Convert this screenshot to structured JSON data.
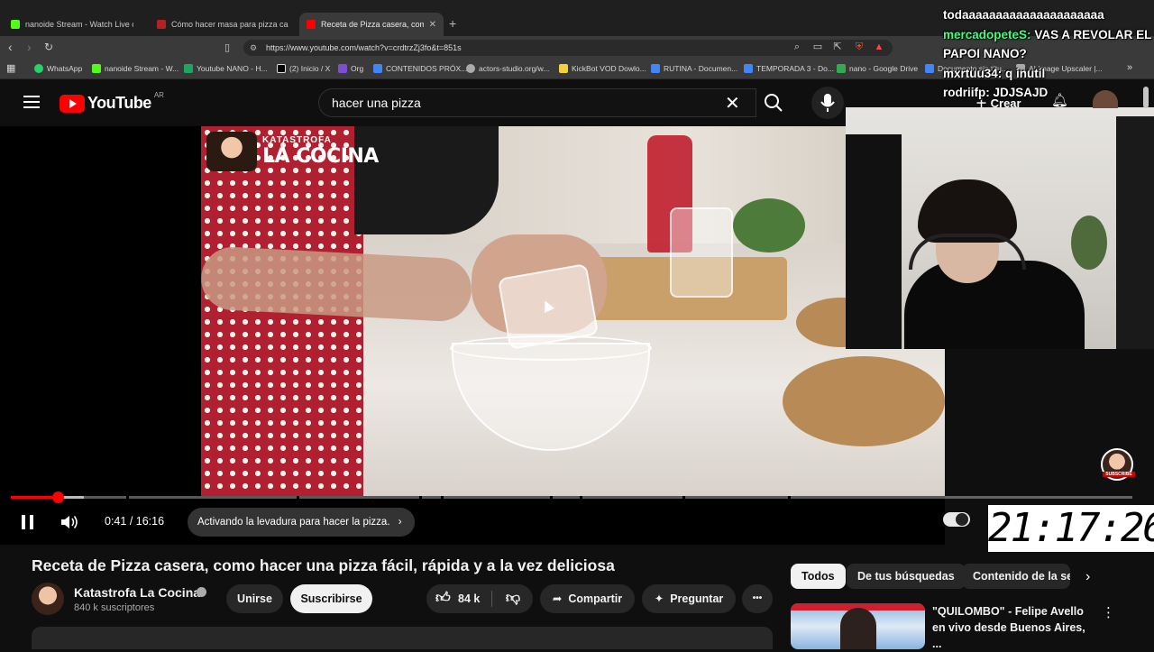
{
  "browser": {
    "tabs": [
      {
        "label": "nanoide Stream - Watch Live on",
        "favicon_color": "#53fc18"
      },
      {
        "label": "Cómo hacer masa para pizza casera",
        "favicon_color": "#b22222"
      },
      {
        "label": "Receta de Pizza casera, como",
        "favicon_color": "#ff0000"
      }
    ],
    "new_tab": "+",
    "url": "https://www.youtube.com/watch?v=crdtrzZj3fo&t=851s",
    "bookmarks": [
      {
        "label": "WhatsApp",
        "color": "#25d366"
      },
      {
        "label": "nanoide Stream - W...",
        "color": "#53fc18"
      },
      {
        "label": "Youtube NANO - H...",
        "color": "#1fa463"
      },
      {
        "label": "(2) Inicio / X",
        "color": "#ffffff"
      },
      {
        "label": "Org",
        "color": "#7b4fcf"
      },
      {
        "label": "CONTENIDOS PRÓX...",
        "color": "#4285f4"
      },
      {
        "label": "actors-studio.org/w...",
        "color": "#aaaaaa"
      },
      {
        "label": "KickBot VOD Dowlo...",
        "color": "#f4d03f"
      },
      {
        "label": "RUTINA - Documen...",
        "color": "#4285f4"
      },
      {
        "label": "TEMPORADA 3 - Do...",
        "color": "#4285f4"
      },
      {
        "label": "nano - Google Drive",
        "color": "#34a853"
      },
      {
        "label": "Documento sin títu...",
        "color": "#4285f4"
      },
      {
        "label": "AI Image Upscaler |...",
        "color": "#aaaaaa"
      }
    ]
  },
  "youtube": {
    "logo_text": "YouTube",
    "country": "AR",
    "search_value": "hacer una pizza",
    "create_label": "Crear"
  },
  "player": {
    "channel_overlay_small": "KATASTROFA",
    "channel_overlay_big": "LA COCINA",
    "time_current": "0:41",
    "time_total": "16:16",
    "time_separator": " / ",
    "chapter": "Activando la levadura para hacer la pizza.",
    "progress_fraction": 0.042,
    "buffer_fraction": 0.065,
    "subscribe_watermark": "SUBSCRIBE",
    "clock": "21:17:26"
  },
  "chat": [
    {
      "user": "",
      "message": "todaaaaaaaaaaaaaaaaaaaaa"
    },
    {
      "user": "mercadopeteS:",
      "message": "VAS A REVOLAR EL PAPOI NANO?"
    },
    {
      "user": "mxrtuu34:",
      "message": "q inutil"
    },
    {
      "user": "rodriifp:",
      "message": "JDJSAJD"
    }
  ],
  "video": {
    "title": "Receta de Pizza casera, como hacer una pizza fácil, rápida y a la vez deliciosa",
    "channel": "Katastrofa La Cocina",
    "subscribers": "840 k suscriptores",
    "join_label": "Unirse",
    "subscribe_label": "Suscribirse",
    "likes": "84 k",
    "share_label": "Compartir",
    "ask_label": "Preguntar",
    "more_label": "•••"
  },
  "sidebar": {
    "chips": [
      "Todos",
      "De tus búsquedas",
      "Contenido de la ser"
    ],
    "next_chevron": "›",
    "recommended": {
      "title": "\"QUILOMBO\" - Felipe Avello en vivo desde Buenos Aires, ...",
      "more": "⋮"
    }
  }
}
